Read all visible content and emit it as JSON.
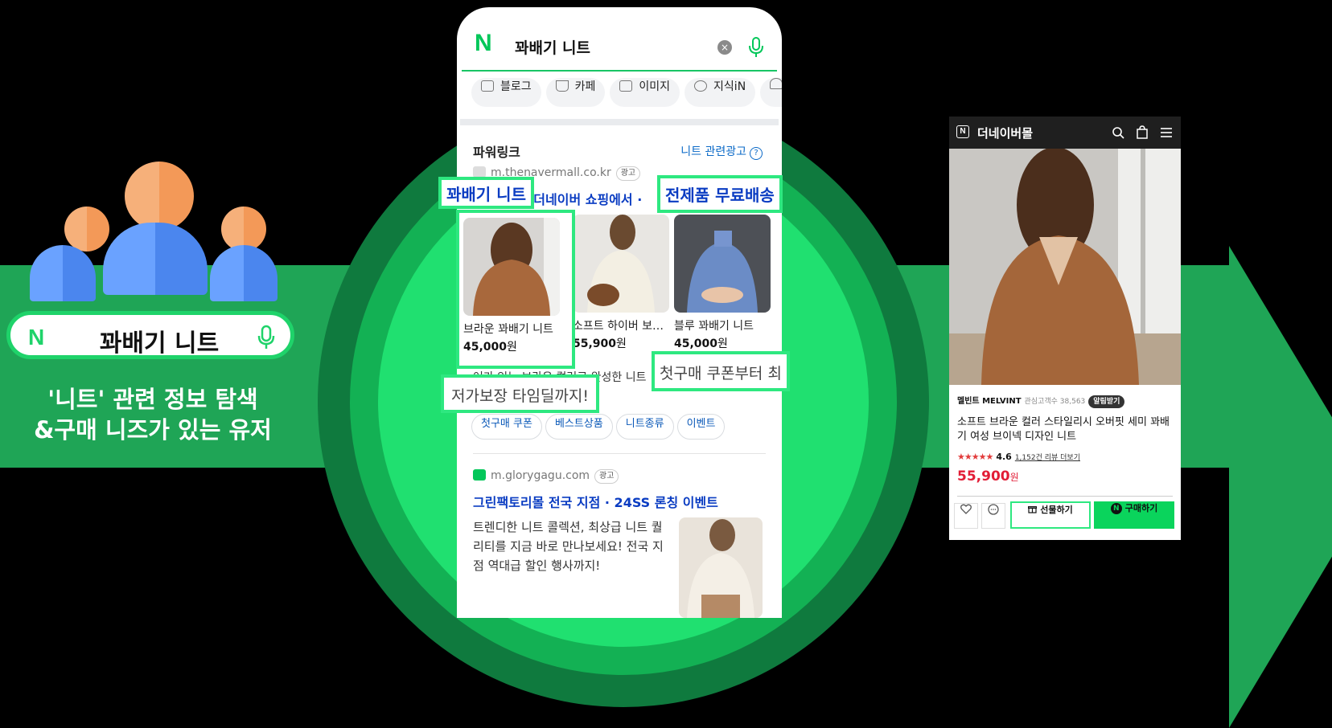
{
  "left": {
    "search_logo": "N",
    "search_query": "꽈배기 니트",
    "caption_line1": "'니트' 관련 정보 탐색",
    "caption_line2": "&구매 니즈가 있는 유저"
  },
  "phone": {
    "logo": "N",
    "query": "꽈배기 니트",
    "clear_glyph": "×",
    "chips": [
      "블로그",
      "카페",
      "이미지",
      "지식iN"
    ],
    "powerlink_label": "파워링크",
    "related_ads_link": "니트 관련광고",
    "help_glyph": "?",
    "ad1": {
      "url": "m.thenavermall.co.kr",
      "ad_tag": "광고",
      "headline_tail": "는 더네이버 쇼핑에서 ·",
      "products": [
        {
          "name": "브라운 꽈배기 니트",
          "price": "45,000",
          "unit": "원"
        },
        {
          "name": "소프트 하이버 보…",
          "price": "55,900",
          "unit": "원"
        },
        {
          "name": "블루 꽈배기 니트",
          "price": "45,000",
          "unit": "원"
        }
      ],
      "desc_visible": "어가 있는 브라운 컬러로 완성한 니트",
      "tags": [
        "첫구매 쿠폰",
        "베스트상품",
        "니트종류",
        "이벤트"
      ]
    },
    "ad2": {
      "url": "m.glorygagu.com",
      "ad_tag": "광고",
      "headline": "그린팩토리몰 전국 지점 · 24SS 론칭 이벤트",
      "desc": "트렌디한 니트 콜렉션, 최상급 니트 퀄리티를 지금 바로 만나보세요! 전국 지점 역대급 할인 행사까지!"
    }
  },
  "callouts": {
    "keyword": "꽈배기 니트",
    "free_shipping": "전제품 무료배송",
    "coupon": "첫구매 쿠폰부터 최",
    "lowest_price": "저가보장 타임딜까지!"
  },
  "shop": {
    "logo": "N",
    "title": "더네이버몰",
    "brand": "멜빈트 MELVINT",
    "followers": "관심고객수 38,563",
    "alarm": "알림받기",
    "product_title": "소프트 브라운 컬러 스타일리시 오버핏 세미 꽈배기 여성 브이넥 디자인 니트",
    "stars": "★★★★★",
    "rating": "4.6",
    "reviews": "1,152건 리뷰 더보기",
    "price": "55,900",
    "unit": "원",
    "gift_label": "선물하기",
    "buy_logo": "N",
    "buy_label": "구매하기"
  },
  "colors": {
    "brand_green": "#03c75a",
    "banner_green": "#1fa556",
    "link_blue": "#0a3cc2",
    "price_red": "#e21d36"
  }
}
